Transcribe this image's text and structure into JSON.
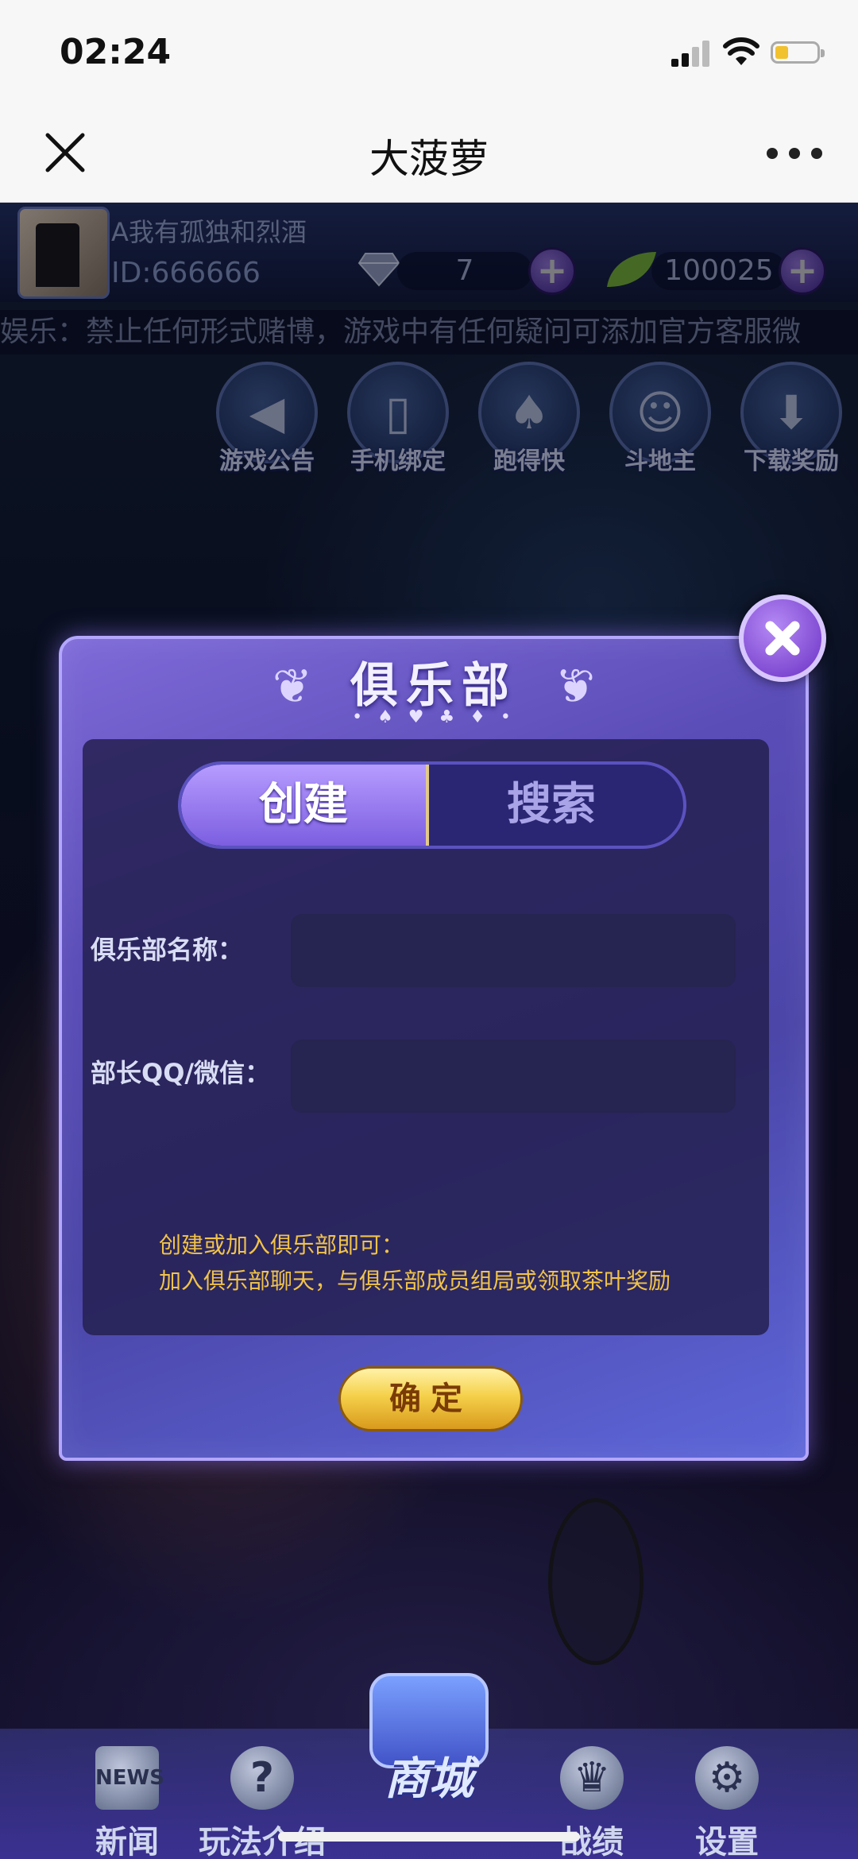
{
  "status_bar": {
    "time": "02:24"
  },
  "browser": {
    "title": "大菠萝"
  },
  "game": {
    "profile": {
      "nickname": "A我有孤独和烈酒",
      "id": "ID:666666"
    },
    "resources": {
      "gems": "7",
      "tea_leaves": "100025",
      "plus_symbol": "+"
    },
    "marquee": "娱乐：禁止任何形式赌博，游戏中有任何疑问可添加官方客服微",
    "features": [
      {
        "label": "游戏公告",
        "icon": "speaker-icon"
      },
      {
        "label": "手机绑定",
        "icon": "phone-icon"
      },
      {
        "label": "跑得快",
        "icon": "cards-icon"
      },
      {
        "label": "斗地主",
        "icon": "character-icon"
      },
      {
        "label": "下载奖励",
        "icon": "download-icon"
      }
    ],
    "bottom_nav": [
      {
        "label": "新闻",
        "icon": "news-icon"
      },
      {
        "label": "玩法介绍",
        "icon": "question-icon"
      },
      {
        "label": "商城",
        "icon": "shop-bag-icon"
      },
      {
        "label": "战绩",
        "icon": "trophy-icon"
      },
      {
        "label": "设置",
        "icon": "gear-icon"
      }
    ]
  },
  "dialog": {
    "title": "俱乐部",
    "tabs": {
      "create": "创建",
      "search": "搜索",
      "active": "create"
    },
    "fields": [
      {
        "label": "俱乐部名称：",
        "value": ""
      },
      {
        "label": "部长QQ/微信：",
        "value": ""
      }
    ],
    "hint_line1": "创建或加入俱乐部即可：",
    "hint_line2": "加入俱乐部聊天，与俱乐部成员组局或领取茶叶奖励",
    "confirm": "确定"
  },
  "colors": {
    "accent": "#7c5ee0",
    "hint": "#f1c34a",
    "confirm": "#f5d04a"
  }
}
